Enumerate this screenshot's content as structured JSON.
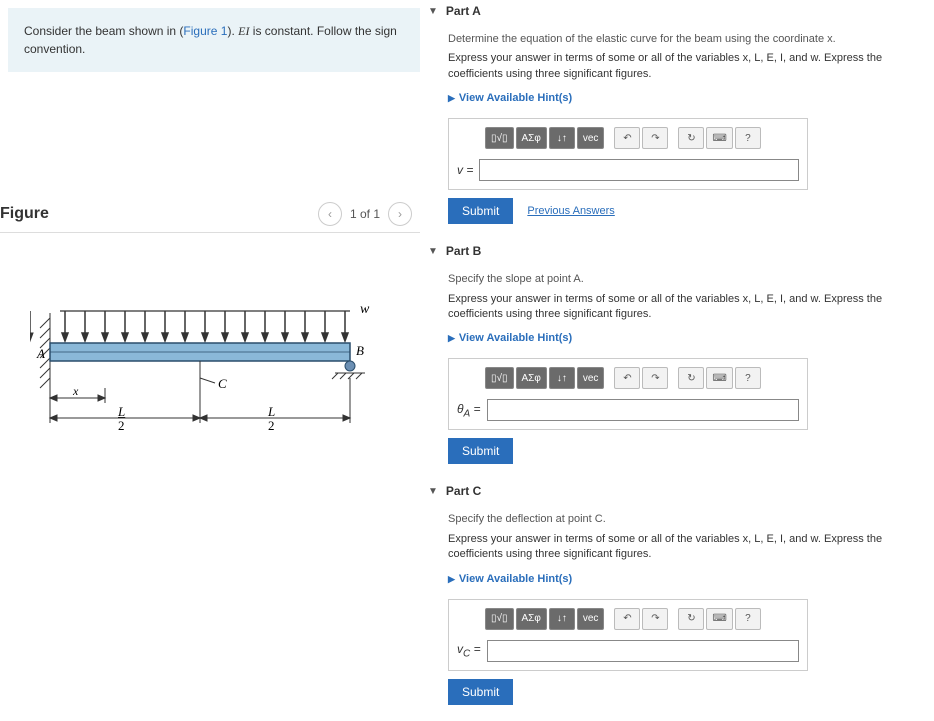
{
  "problem": {
    "text_a": "Consider the beam shown in (",
    "figref": "Figure 1",
    "text_b": "). ",
    "ei": "EI",
    "text_c": " is constant. Follow the sign convention."
  },
  "figure": {
    "title": "Figure",
    "pager": "1 of 1",
    "labels": {
      "w": "w",
      "A": "A",
      "B": "B",
      "C": "C",
      "x": "x",
      "half1": "L/2",
      "half2": "L/2"
    }
  },
  "parts": {
    "a": {
      "header": "Part A",
      "line1": "Determine the equation of the elastic curve for the beam using the coordinate x.",
      "line2": "Express your answer in terms of some or all of the variables x, L, E, I, and w. Express the coefficients using three significant figures.",
      "hints": "View Available Hint(s)",
      "var": "v =",
      "submit": "Submit",
      "prev": "Previous Answers"
    },
    "b": {
      "header": "Part B",
      "line1": "Specify the slope at point A.",
      "line2": "Express your answer in terms of some or all of the variables x, L, E, I, and w. Express the coefficients using three significant figures.",
      "hints": "View Available Hint(s)",
      "var": "θA =",
      "submit": "Submit"
    },
    "c": {
      "header": "Part C",
      "line1": "Specify the deflection at point C.",
      "line2": "Express your answer in terms of some or all of the variables x, L, E, I, and w. Express the coefficients using three significant figures.",
      "hints": "View Available Hint(s)",
      "var": "vC =",
      "submit": "Submit"
    }
  },
  "toolbar": {
    "tpl": "▯√▯",
    "greek": "ΑΣφ",
    "updown": "↓↑",
    "vec": "vec",
    "undo": "↶",
    "redo": "↷",
    "reset": "↻",
    "keyb": "⌨",
    "help": "?"
  }
}
